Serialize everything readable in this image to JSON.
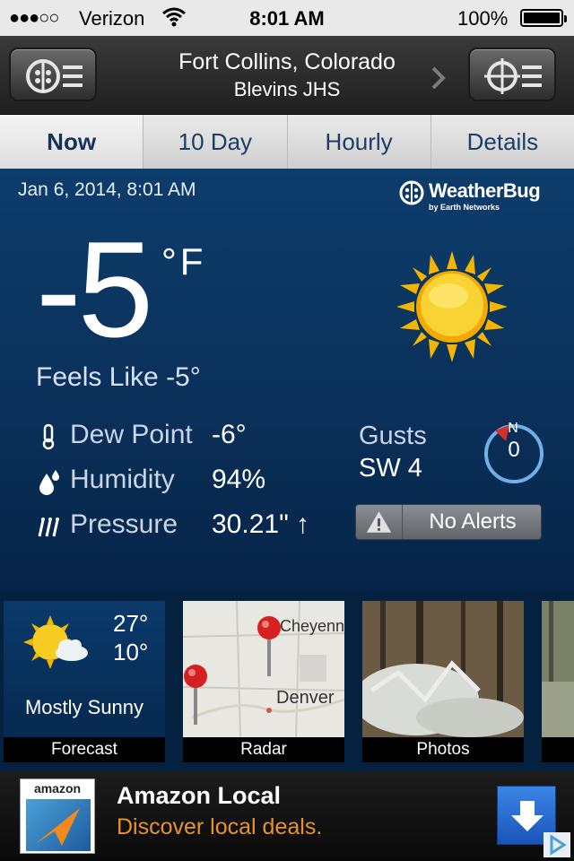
{
  "status_bar": {
    "signal": "●●●○○",
    "carrier": "Verizon",
    "time": "8:01 AM",
    "battery": "100%"
  },
  "header": {
    "location": "Fort Collins, Colorado",
    "station": "Blevins JHS"
  },
  "tabs": [
    {
      "label": "Now",
      "active": true
    },
    {
      "label": "10 Day",
      "active": false
    },
    {
      "label": "Hourly",
      "active": false
    },
    {
      "label": "Details",
      "active": false
    }
  ],
  "current": {
    "datetime": "Jan 6, 2014, 8:01 AM",
    "brand": "WeatherBug",
    "brand_sub": "by Earth Networks",
    "temperature": "-5",
    "unit": "°F",
    "feels_like": "Feels Like -5°",
    "dew_point_label": "Dew Point",
    "dew_point": "-6°",
    "humidity_label": "Humidity",
    "humidity": "94%",
    "pressure_label": "Pressure",
    "pressure": "30.21\" ↑",
    "gusts_label": "Gusts",
    "gusts": "SW 4",
    "wind_dir": "N",
    "wind_speed": "0",
    "alerts": "No Alerts"
  },
  "tiles": {
    "forecast": {
      "high": "27°",
      "low": "10°",
      "condition": "Mostly Sunny",
      "caption": "Forecast"
    },
    "radar": {
      "caption": "Radar",
      "city1": "Cheyenn",
      "city2": "Denver"
    },
    "photos": {
      "caption": "Photos"
    }
  },
  "ad": {
    "logo_word": "amazon",
    "title": "Amazon Local",
    "subtitle": "Discover local deals."
  },
  "colors": {
    "main_bg": "#0a2f58",
    "tab_text": "#1d3d66",
    "ad_accent": "#e8922e",
    "sun": "#f7c21a"
  }
}
